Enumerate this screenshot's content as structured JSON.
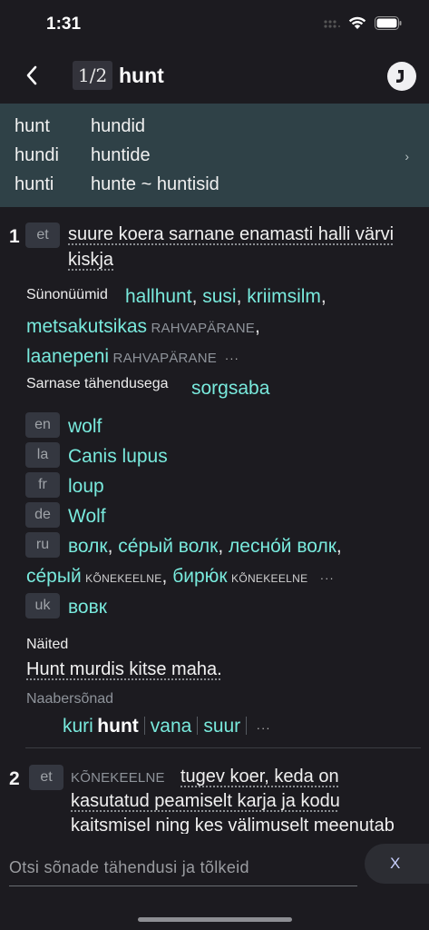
{
  "status_bar": {
    "time": "1:31"
  },
  "nav": {
    "page_counter": "1/2",
    "title": "hunt"
  },
  "forms": [
    {
      "singular": "hunt",
      "plural": "hundid"
    },
    {
      "singular": "hundi",
      "plural": "huntide"
    },
    {
      "singular": "hunti",
      "plural": "hunte ~ huntisid"
    }
  ],
  "sense1": {
    "number": "1",
    "lang": "et",
    "definition_line1": "suure koera sarnane enamasti halli värvi",
    "definition_line2": "kiskja",
    "synonyms_label": "Sünonüümid",
    "syn": [
      "hallhunt",
      "susi",
      "kriimsilm",
      "metsakutsikas",
      "laanepeni"
    ],
    "syn_tag": "RAHVAPÄRANE",
    "similar_label": "Sarnase tähendusega",
    "similar": "sorgsaba",
    "translations": [
      {
        "lang": "en",
        "text": "wolf"
      },
      {
        "lang": "la",
        "text": "Canis lupus"
      },
      {
        "lang": "fr",
        "text": "loup"
      },
      {
        "lang": "de",
        "text": "Wolf"
      },
      {
        "lang": "ru",
        "words": [
          "волк",
          "се́рый волк",
          "лесно́й волк",
          "се́рый",
          "бирю́к"
        ],
        "tag": "KÕNEKEELNE"
      },
      {
        "lang": "uk",
        "text": "вовк"
      }
    ],
    "examples_label": "Näited",
    "example": "Hunt murdis kitse maha.",
    "neighbors_label": "Naabersõnad",
    "neighbors": [
      "kuri",
      "hunt",
      "vana",
      "suur"
    ]
  },
  "sense2": {
    "number": "2",
    "lang": "et",
    "tag": "KÕNEKEELNE",
    "definition_line1": "tugev koer, keda on",
    "definition_line2": "kasutatud peamiselt karja ja kodu",
    "definition_line3": "kaitsmisel ning kes välimuselt meenutab"
  },
  "search": {
    "placeholder": "Otsi sõnade tähendusi ja tõlkeid",
    "clear_label": "X"
  },
  "ellipsis": "···"
}
